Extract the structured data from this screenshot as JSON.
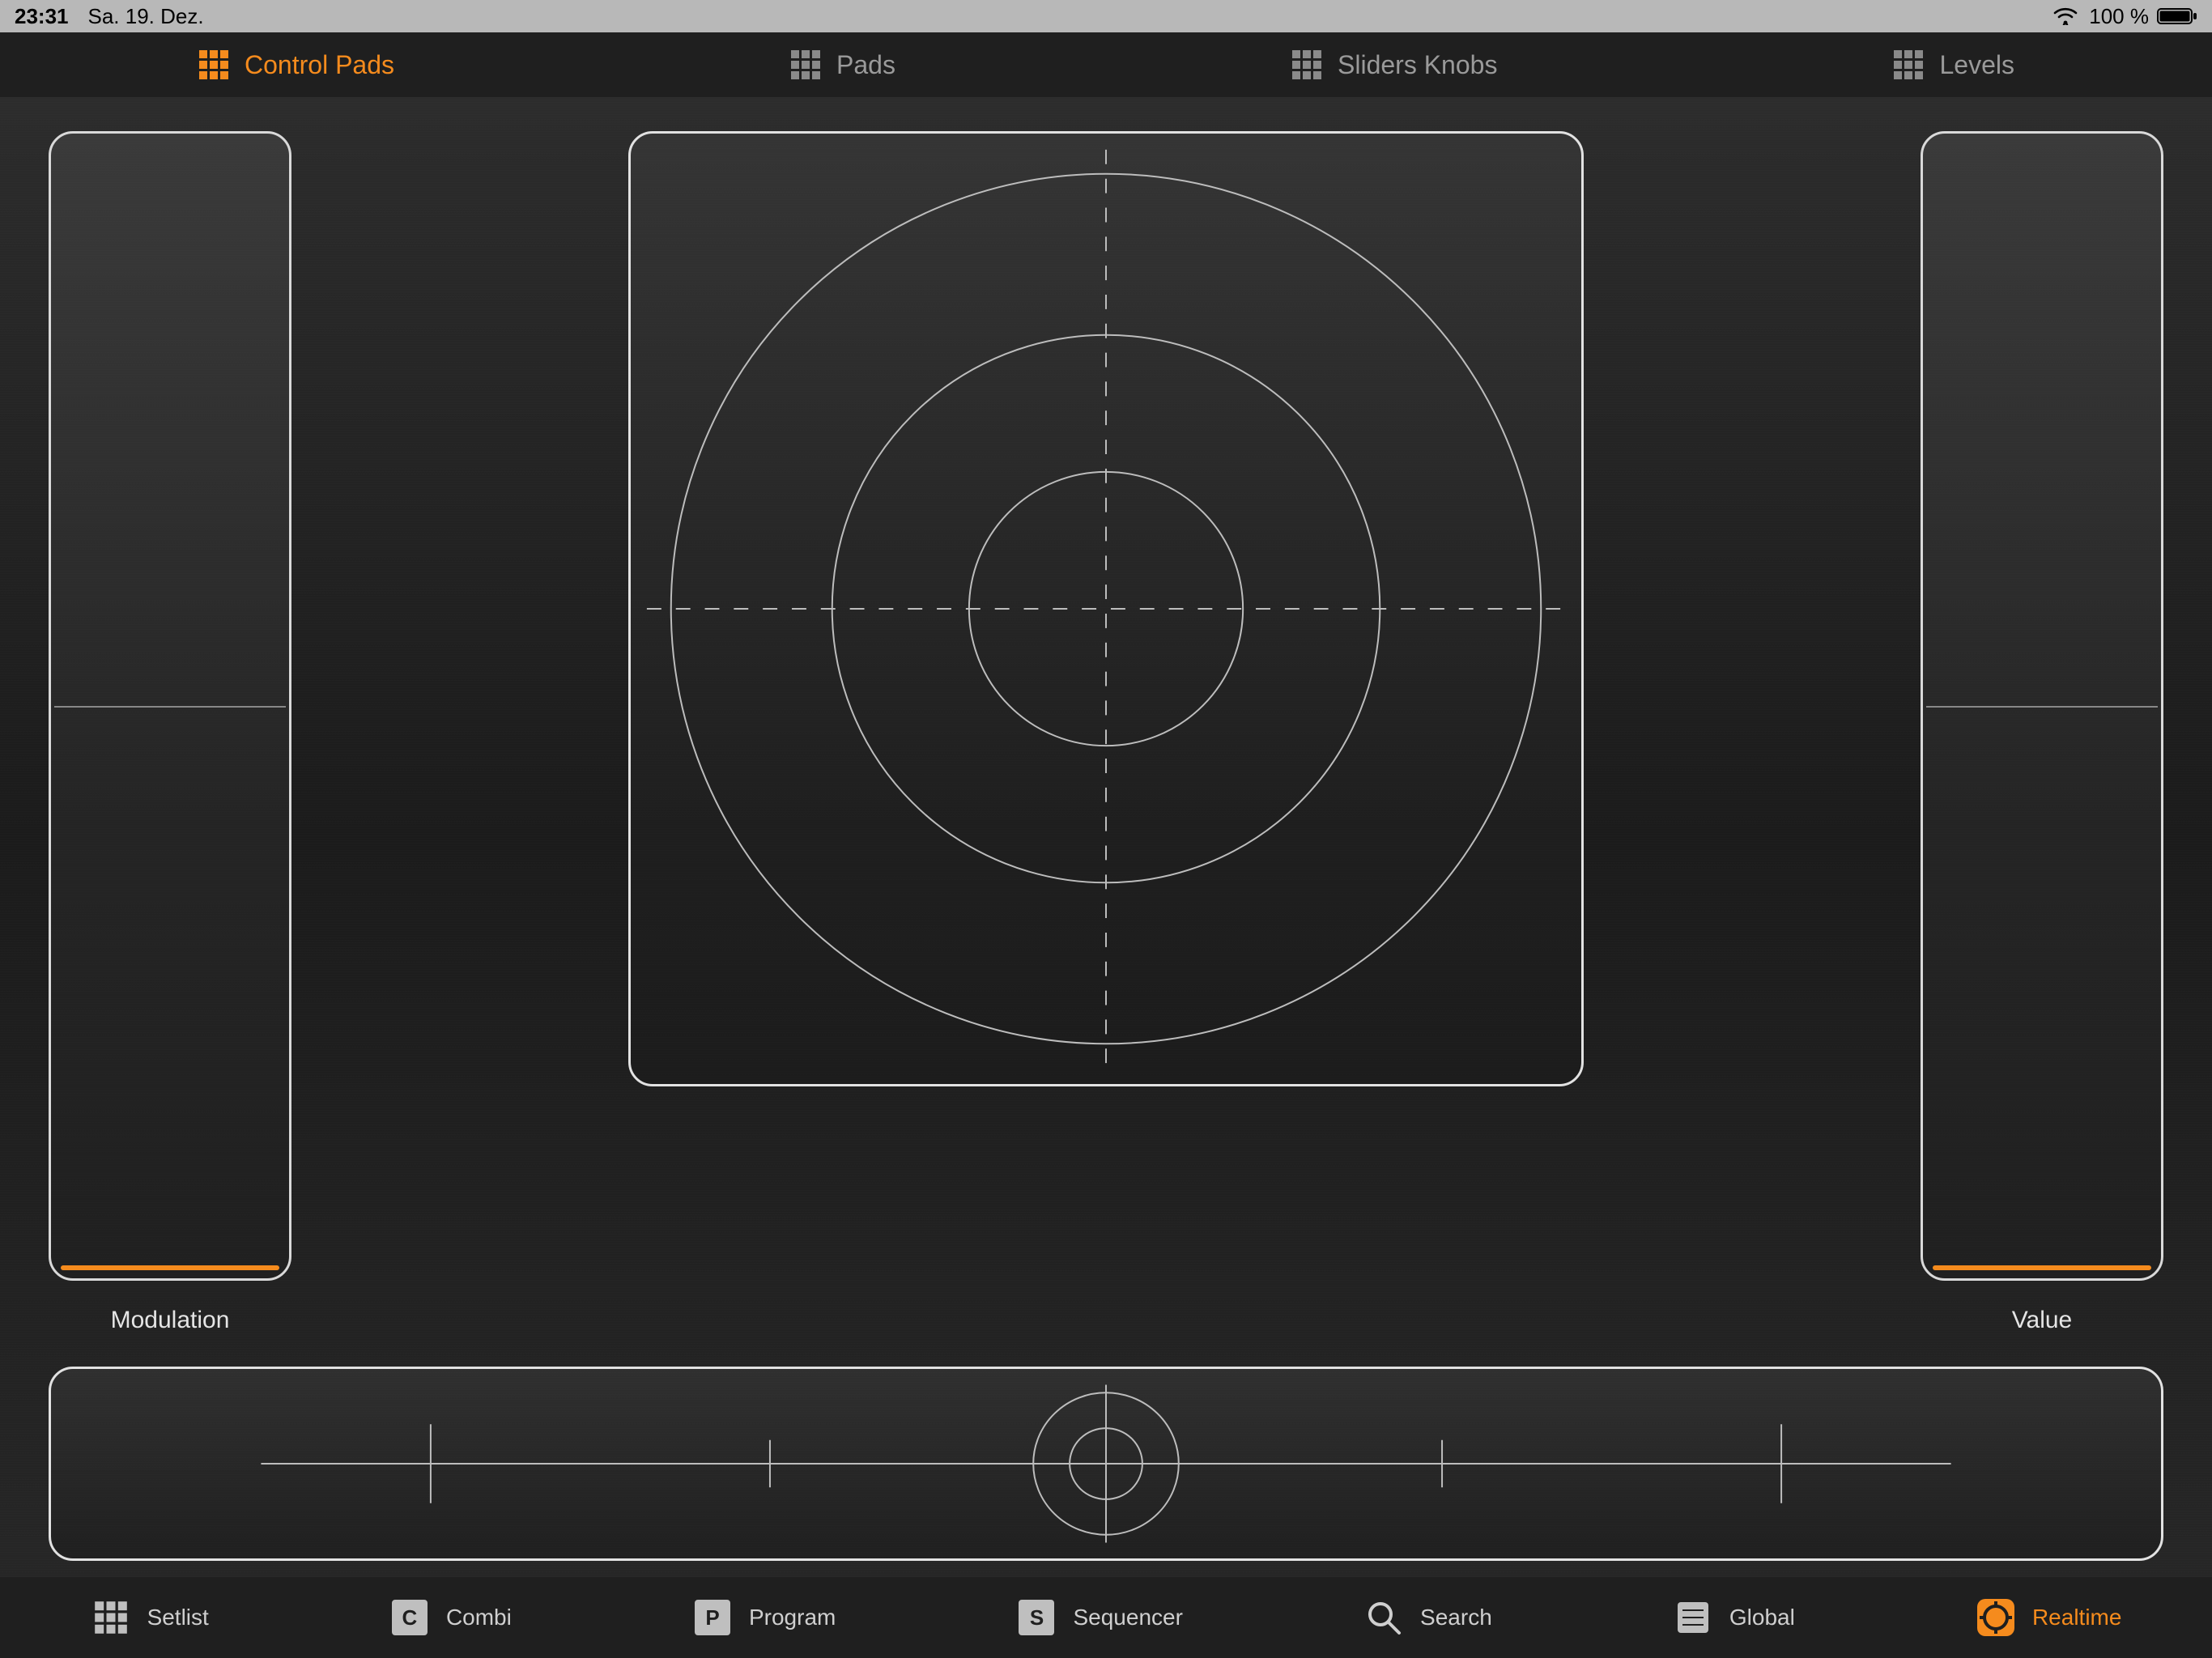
{
  "status": {
    "time": "23:31",
    "date": "Sa. 19. Dez.",
    "battery_pct": "100 %"
  },
  "top_tabs": {
    "active_index": 0,
    "items": [
      {
        "label": "Control Pads"
      },
      {
        "label": "Pads"
      },
      {
        "label": "Sliders Knobs"
      },
      {
        "label": "Levels"
      }
    ]
  },
  "controls": {
    "left_pad_label": "Modulation",
    "right_pad_label": "Value"
  },
  "bottom_bar": {
    "active_index": 6,
    "items": [
      {
        "label": "Setlist"
      },
      {
        "label": "Combi"
      },
      {
        "label": "Program"
      },
      {
        "label": "Sequencer"
      },
      {
        "label": "Search"
      },
      {
        "label": "Global"
      },
      {
        "label": "Realtime"
      }
    ]
  },
  "colors": {
    "accent": "#f58b1d"
  }
}
